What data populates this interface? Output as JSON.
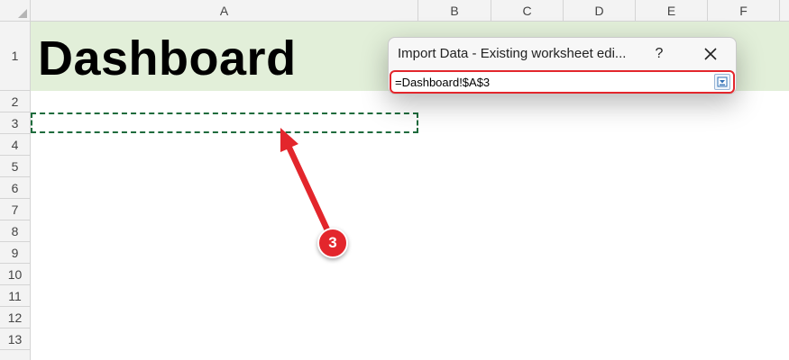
{
  "sheet": {
    "columns": [
      "A",
      "B",
      "C",
      "D",
      "E",
      "F"
    ],
    "rows": [
      "1",
      "2",
      "3",
      "4",
      "5",
      "6",
      "7",
      "8",
      "9",
      "10",
      "11",
      "12",
      "13"
    ],
    "cell_a1": "Dashboard",
    "header_band_color": "#e2efd9"
  },
  "dialog": {
    "title": "Import Data - Existing worksheet edi...",
    "help_label": "?",
    "reference_value": "=Dashboard!$A$3",
    "close_icon": "close-icon",
    "collapse_icon": "collapse-dialog-icon"
  },
  "annotation": {
    "step_number": "3",
    "color": "#e3262c"
  }
}
